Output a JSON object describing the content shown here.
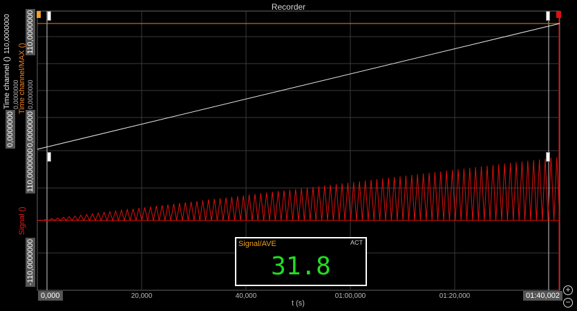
{
  "title": "Recorder",
  "upper_axes": {
    "left_channel_label": "Time channel ()",
    "left_top_value": "110,0000000",
    "left_bottom_value": "0,0000000",
    "right_channel_label": "Time channel/MAX ()",
    "right_top_value": "110,0000000",
    "right_bottom_value": "0,0000000",
    "left_mid_value": "0,0000000",
    "right_mid_value": "0,0000000"
  },
  "lower_axes": {
    "channel_label": "Signal ()",
    "top_value": "110,0000000",
    "bottom_value": "-110,0000000"
  },
  "x_axis": {
    "label": "t (s)",
    "start_value": "0,000",
    "end_value": "01:40,002",
    "ticks": [
      "20,000",
      "40,000",
      "01:00,000",
      "01:20,000"
    ]
  },
  "display": {
    "name": "Signal/AVE",
    "mode": "ACT",
    "value": "31.8"
  },
  "zoom": {
    "in": "+",
    "out": "−"
  },
  "colors": {
    "signal": "#e01010",
    "max": "#f08020",
    "time": "#e8e8e8",
    "value": "#22dd22"
  }
}
